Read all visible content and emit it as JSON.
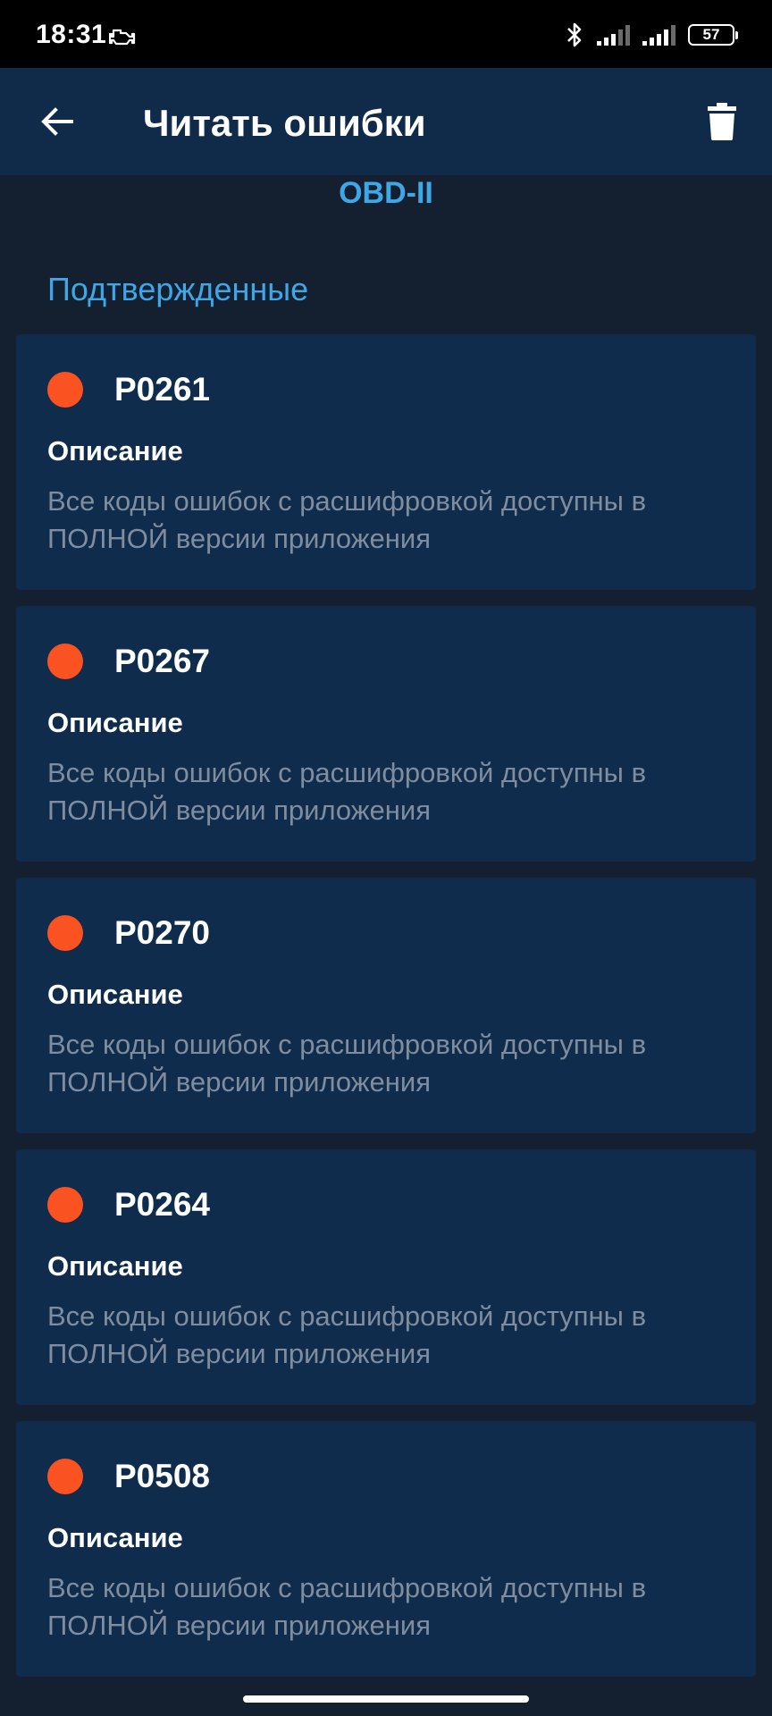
{
  "status_bar": {
    "time": "18:31",
    "battery": "57",
    "icons": [
      "engine-icon",
      "bluetooth-icon",
      "signal-icon",
      "signal-icon",
      "battery-icon"
    ]
  },
  "app_bar": {
    "title": "Читать ошибки",
    "back_icon": "arrow-left-icon",
    "delete_icon": "trash-icon"
  },
  "protocol": "OBD-II",
  "section": {
    "title": "Подтвержденные"
  },
  "errors": [
    {
      "code": "P0261",
      "description_label": "Описание",
      "description": "Все коды ошибок с расшифровкой доступны в ПОЛНОЙ версии приложения"
    },
    {
      "code": "P0267",
      "description_label": "Описание",
      "description": "Все коды ошибок с расшифровкой доступны в ПОЛНОЙ версии приложения"
    },
    {
      "code": "P0270",
      "description_label": "Описание",
      "description": "Все коды ошибок с расшифровкой доступны в ПОЛНОЙ версии приложения"
    },
    {
      "code": "P0264",
      "description_label": "Описание",
      "description": "Все коды ошибок с расшифровкой доступны в ПОЛНОЙ версии приложения"
    },
    {
      "code": "P0508",
      "description_label": "Описание",
      "description": "Все коды ошибок с расшифровкой доступны в ПОЛНОЙ версии приложения"
    }
  ],
  "colors": {
    "accent": "#3ea7e8",
    "error_dot": "#fb5222",
    "card_bg": "#0f2c4c",
    "app_bar_bg": "#102b4a",
    "page_bg": "#14202f",
    "muted_text": "#7f8d9e"
  }
}
